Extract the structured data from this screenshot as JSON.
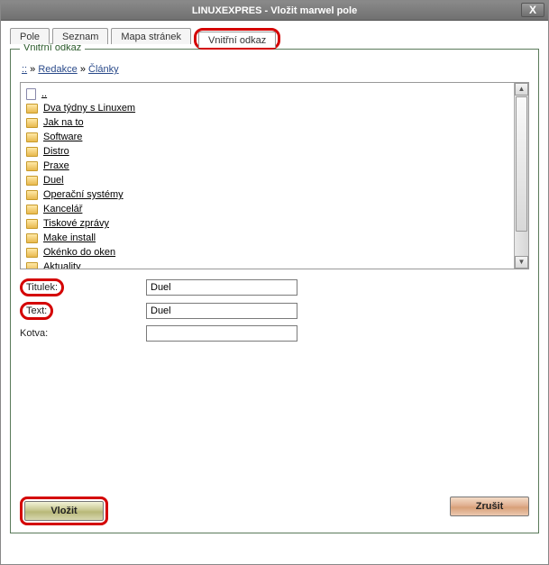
{
  "window": {
    "title": "LINUXEXPRES - Vložit marwel pole",
    "close": "X"
  },
  "tabs": {
    "pole": "Pole",
    "seznam": "Seznam",
    "mapa": "Mapa stránek",
    "vnitrni": "Vnitřní odkaz"
  },
  "fieldset_legend": "Vnitřní odkaz",
  "breadcrumb": {
    "root": "::",
    "sep": " » ",
    "seg1": "Redakce",
    "seg2": "Články"
  },
  "files": {
    "up": "..",
    "items": [
      "Dva týdny s Linuxem",
      "Jak na to",
      "Software",
      "Distro",
      "Praxe",
      "Duel",
      "Operační systémy",
      "Kancelář",
      "Tiskové zprávy",
      "Make install",
      "Okénko do oken",
      "Aktuality"
    ]
  },
  "form": {
    "titulek_label": "Titulek:",
    "titulek_value": "Duel",
    "text_label": "Text:",
    "text_value": "Duel",
    "kotva_label": "Kotva:",
    "kotva_value": ""
  },
  "buttons": {
    "insert": "Vložit",
    "cancel": "Zrušit"
  }
}
